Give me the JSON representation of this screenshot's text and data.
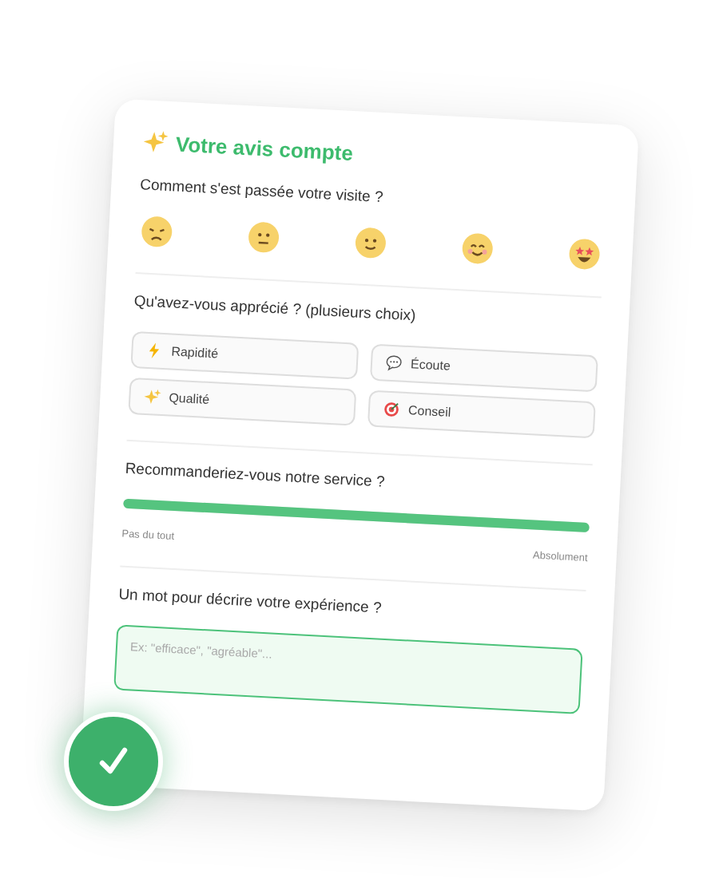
{
  "card": {
    "title": "Votre avis compte"
  },
  "visit": {
    "question": "Comment s'est passée votre visite ?",
    "faces": [
      {
        "kind": "sad"
      },
      {
        "kind": "neutral"
      },
      {
        "kind": "smile"
      },
      {
        "kind": "happy"
      },
      {
        "kind": "starstruck"
      }
    ]
  },
  "appreciated": {
    "question": "Qu'avez-vous apprécié ? (plusieurs choix)",
    "options": [
      {
        "label": "Rapidité",
        "kind": "bolt"
      },
      {
        "label": "Écoute",
        "kind": "speech"
      },
      {
        "label": "Qualité",
        "kind": "sparkle"
      },
      {
        "label": "Conseil",
        "kind": "target"
      }
    ]
  },
  "recommend": {
    "question": "Recommanderiez-vous notre service ?",
    "level": 1,
    "min_label": "Pas du tout",
    "max_label": "Absolument"
  },
  "word": {
    "question": "Un mot pour décrire votre expérience ?",
    "placeholder": "Ex: \"efficace\", \"agréable\"..."
  }
}
